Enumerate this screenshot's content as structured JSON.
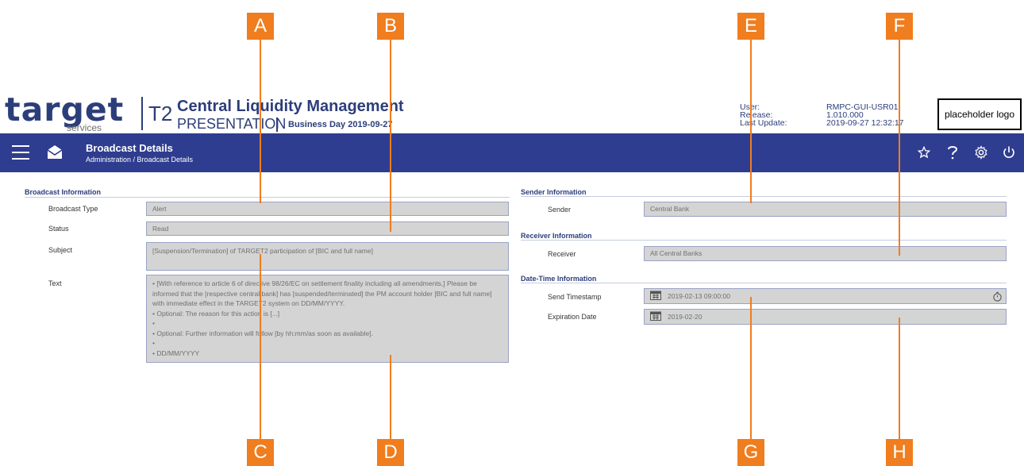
{
  "callouts": [
    "A",
    "B",
    "C",
    "D",
    "E",
    "F",
    "G",
    "H"
  ],
  "header": {
    "logo_word": "target",
    "logo_sub": "services",
    "app_code": "T2",
    "app_name": "Central Liquidity Management",
    "environment": "PRESENTATION",
    "business_day": "Business Day 2019-09-27",
    "user_label": "User:",
    "user_value": "RMPC-GUI-USR01",
    "release_label": "Release:",
    "release_value": "1.010.000",
    "update_label": "Last Update:",
    "update_value": "2019-09-27 12:32:17",
    "placeholder_logo": "placeholder logo"
  },
  "nav": {
    "title": "Broadcast Details",
    "breadcrumb": "Administration  /  Broadcast Details",
    "icons": [
      "menu-icon",
      "envelope-icon",
      "star-icon",
      "help-icon",
      "settings-icon",
      "power-icon"
    ]
  },
  "broadcast": {
    "section": "Broadcast Information",
    "type_label": "Broadcast Type",
    "type_value": "Alert",
    "status_label": "Status",
    "status_value": "Read",
    "subject_label": "Subject",
    "subject_value": "[Suspension/Termination] of TARGET2 participation of [BIC and full name]",
    "text_label": "Text",
    "text_lines": [
      "• [With reference to article 6 of directive 98/26/EC on settlement finality including all amendments,] Please be",
      "informed that the [respective central bank] has [suspended/terminated] the PM account holder [BIC and full name]",
      "with immediate effect in the TARGET2 system on DD/MM/YYYY.",
      "• Optional: The reason for this action is [...]",
      "•",
      "• Optional: Further information will follow [by hh:mm/as soon as available].",
      "•",
      "• DD/MM/YYYY"
    ]
  },
  "sender": {
    "section": "Sender Information",
    "label": "Sender",
    "value": "Central Bank"
  },
  "receiver": {
    "section": "Receiver Information",
    "label": "Receiver",
    "value": "All Central Banks"
  },
  "datetime": {
    "section": "Date-Time Information",
    "send_label": "Send Timestamp",
    "send_value": "2019-02-13 09:00:00",
    "exp_label": "Expiration Date",
    "exp_value": "2019-02-20"
  },
  "colors": {
    "navbar": "#2e3d8f",
    "brand": "#2c3e7a",
    "callout": "#f07d1e",
    "field_bg": "#d4d4d4"
  }
}
